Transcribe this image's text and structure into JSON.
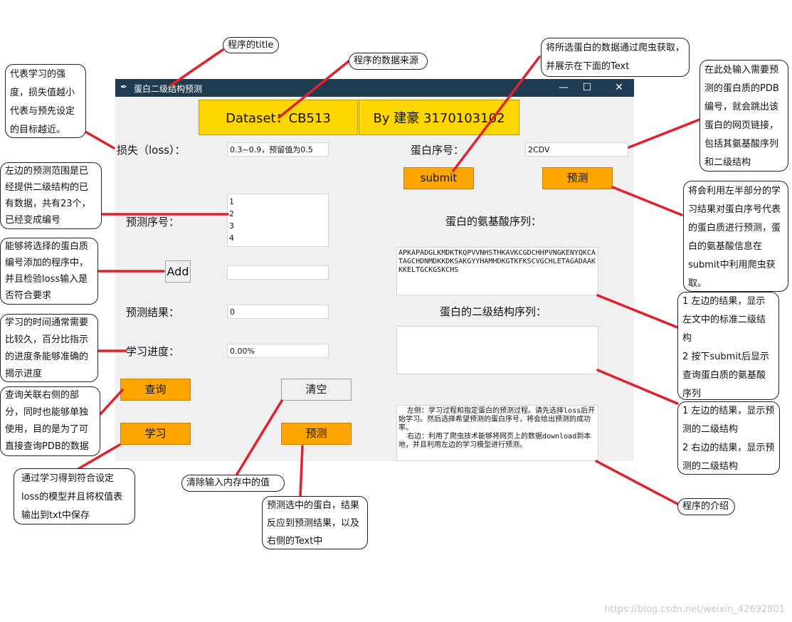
{
  "window": {
    "title": "蛋白二级结构预测"
  },
  "banner": {
    "dataset": "Dataset：CB513",
    "author": "By 建豪 3170103102"
  },
  "left": {
    "loss_label": "损失（loss）：",
    "loss_value": "0.3~0.9，预留值为0.5",
    "seq_label": "预测序号：",
    "seq_items": [
      "1",
      "2",
      "3",
      "4"
    ],
    "add_button": "Add",
    "add_value": "",
    "result_label": "预测结果：",
    "result_value": "0",
    "progress_label": "学习进度：",
    "progress_value": "0.00%",
    "query_button": "查询",
    "clear_button": "清空",
    "learn_button": "学习",
    "predict_button": "预测"
  },
  "right": {
    "protein_label": "蛋白序号：",
    "protein_value": "2CDV",
    "submit_button": "submit",
    "predict_button": "预测",
    "amino_label": "蛋白的氨基酸序列：",
    "amino_text": "APKAPADGLKMDKTKQPVVNHSTHKAVKCGDCHHPVNGKENYQKCATAGCHDNMDKKDKSAKGYYHAMHDKGTKFKSCVGCHLETAGADAAKKKELTGCKGSKCHS",
    "secondary_label": "蛋白的二级结构序列：",
    "secondary_text": "",
    "intro_text": "  左侧：学习过程和指定蛋白的预测过程。请先选择loss后开始学习。然后选择希望预测的蛋白序号，将会给出预测的成功率。\n  右边：利用了爬虫技术能够将网页上的数据download到本地，并且利用左边的学习模型进行预测。"
  },
  "notes": {
    "title_note": "程序的title",
    "data_source": "程序的数据来源",
    "crawler": "将所选蛋白的数据通过爬虫获取，并展示在下面的Text",
    "pdb_input": "在此处输入需要预测的蛋白质的PDB编号，就会跳出该蛋白的网页链接，包括其氨基酸序列和二级结构",
    "loss": "代表学习的强度，损失值越小代表与预先设定的目标越近。",
    "range": "左边的预测范围是已经提供二级结构的已有数据，共有23个，已经变成编号",
    "add": "能够将选择的蛋白质编号添加的程序中，并且检验loss输入是否符合要求",
    "progress": "学习的时间通常需要比较久，百分比指示的进度条能够准确的揭示进度",
    "query": "查询关联右侧的部分，同时也能够单独使用，目的是为了可直接查询PDB的数据",
    "learn": "通过学习得到符合设定loss的模型并且将权值表输出到txt中保存",
    "clear": "清除输入内存中的值",
    "predict_left": "预测选中的蛋白，结果反应到预测结果，以及右侧的Text中",
    "predict_right": "将会利用左半部分的学习结果对蛋白序号代表的蛋白质进行预测，蛋白的氨基酸信息在submit中利用爬虫获取。",
    "amino_result": "1 左边的结果，显示左文中的标准二级结构\n2 按下submit后显示查询蛋白质的氨基酸序列",
    "secondary_result": "1 左边的结果，显示预测的二级结构\n2 右边的结果，显示预测的二级结构",
    "intro": "程序的介绍"
  },
  "watermark": "https://blog.csdn.net/weixin_42692801",
  "colors": {
    "titlebar": "#1f3b52",
    "banner": "#ffd700",
    "button": "#ffa500",
    "arrow": "#e0202a"
  }
}
